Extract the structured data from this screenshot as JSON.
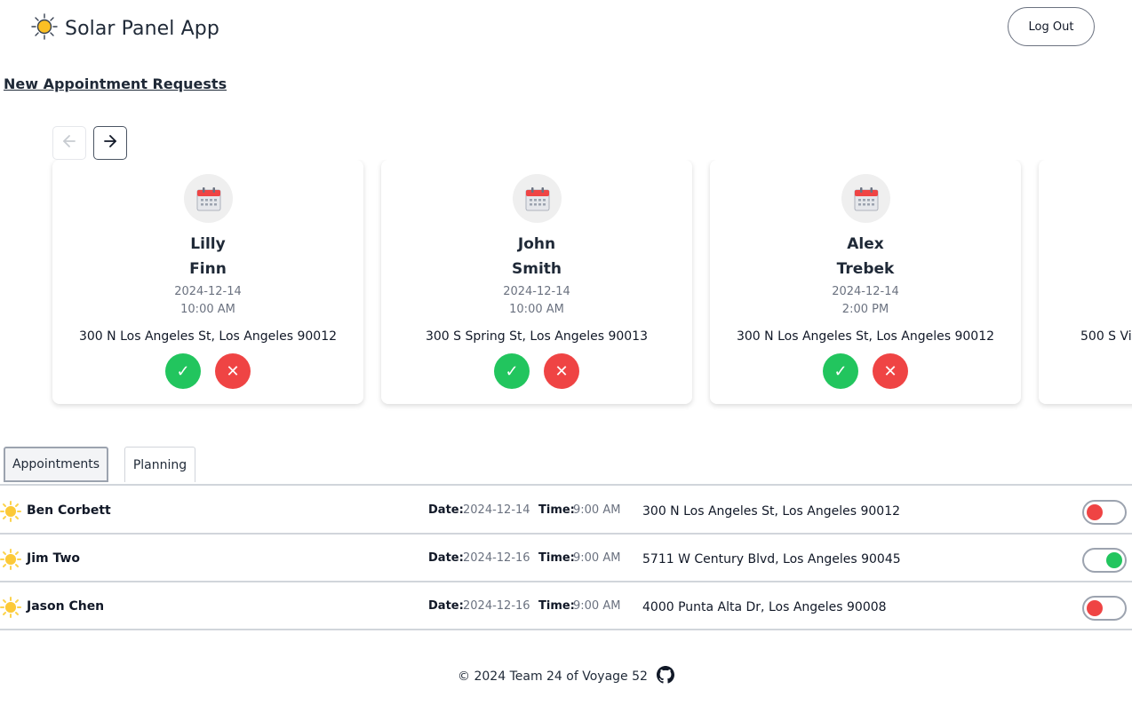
{
  "header": {
    "title": "Solar Panel App",
    "logout_label": "Log Out",
    "logo_icon": "sun-icon"
  },
  "requests": {
    "title": "New Appointment Requests",
    "prev_icon": "arrow-left-icon",
    "next_icon": "arrow-right-icon",
    "cards": [
      {
        "first": "Lilly",
        "last": "Finn",
        "date": "2024-12-14",
        "time": "10:00 AM",
        "address": "300 N Los Angeles St, Los Angeles 90012",
        "accept": "✓",
        "decline": "✕"
      },
      {
        "first": "John",
        "last": "Smith",
        "date": "2024-12-14",
        "time": "10:00 AM",
        "address": "300 S Spring St, Los Angeles 90013",
        "accept": "✓",
        "decline": "✕"
      },
      {
        "first": "Alex",
        "last": "Trebek",
        "date": "2024-12-14",
        "time": "2:00 PM",
        "address": "300 N Los Angeles St, Los Angeles 90012",
        "accept": "✓",
        "decline": "✕"
      },
      {
        "first": "",
        "last": "",
        "date": "",
        "time": "",
        "address": "500 S Vi",
        "accept": "",
        "decline": ""
      }
    ]
  },
  "tabs": [
    {
      "label": "Appointments",
      "active": true
    },
    {
      "label": "Planning",
      "active": false
    }
  ],
  "appointments": {
    "date_label": "Date:",
    "time_label": "Time:",
    "rows": [
      {
        "name": "Ben Corbett",
        "date": "2024-12-14",
        "time": "9:00 AM",
        "address": "300 N Los Angeles St, Los Angeles 90012",
        "toggle_on": false
      },
      {
        "name": "Jim Two",
        "date": "2024-12-16",
        "time": "9:00 AM",
        "address": "5711 W Century Blvd, Los Angeles 90045",
        "toggle_on": true
      },
      {
        "name": "Jason Chen",
        "date": "2024-12-16",
        "time": "9:00 AM",
        "address": "4000 Punta Alta Dr, Los Angeles 90008",
        "toggle_on": false
      }
    ]
  },
  "footer": {
    "text": "© 2024 Team 24 of Voyage 52",
    "icon": "github-icon"
  },
  "colors": {
    "accept": "#22c55e",
    "decline": "#ef4444",
    "toggle_on": "#22c55e",
    "toggle_off": "#ef4444",
    "sun": "#fcd34d"
  }
}
